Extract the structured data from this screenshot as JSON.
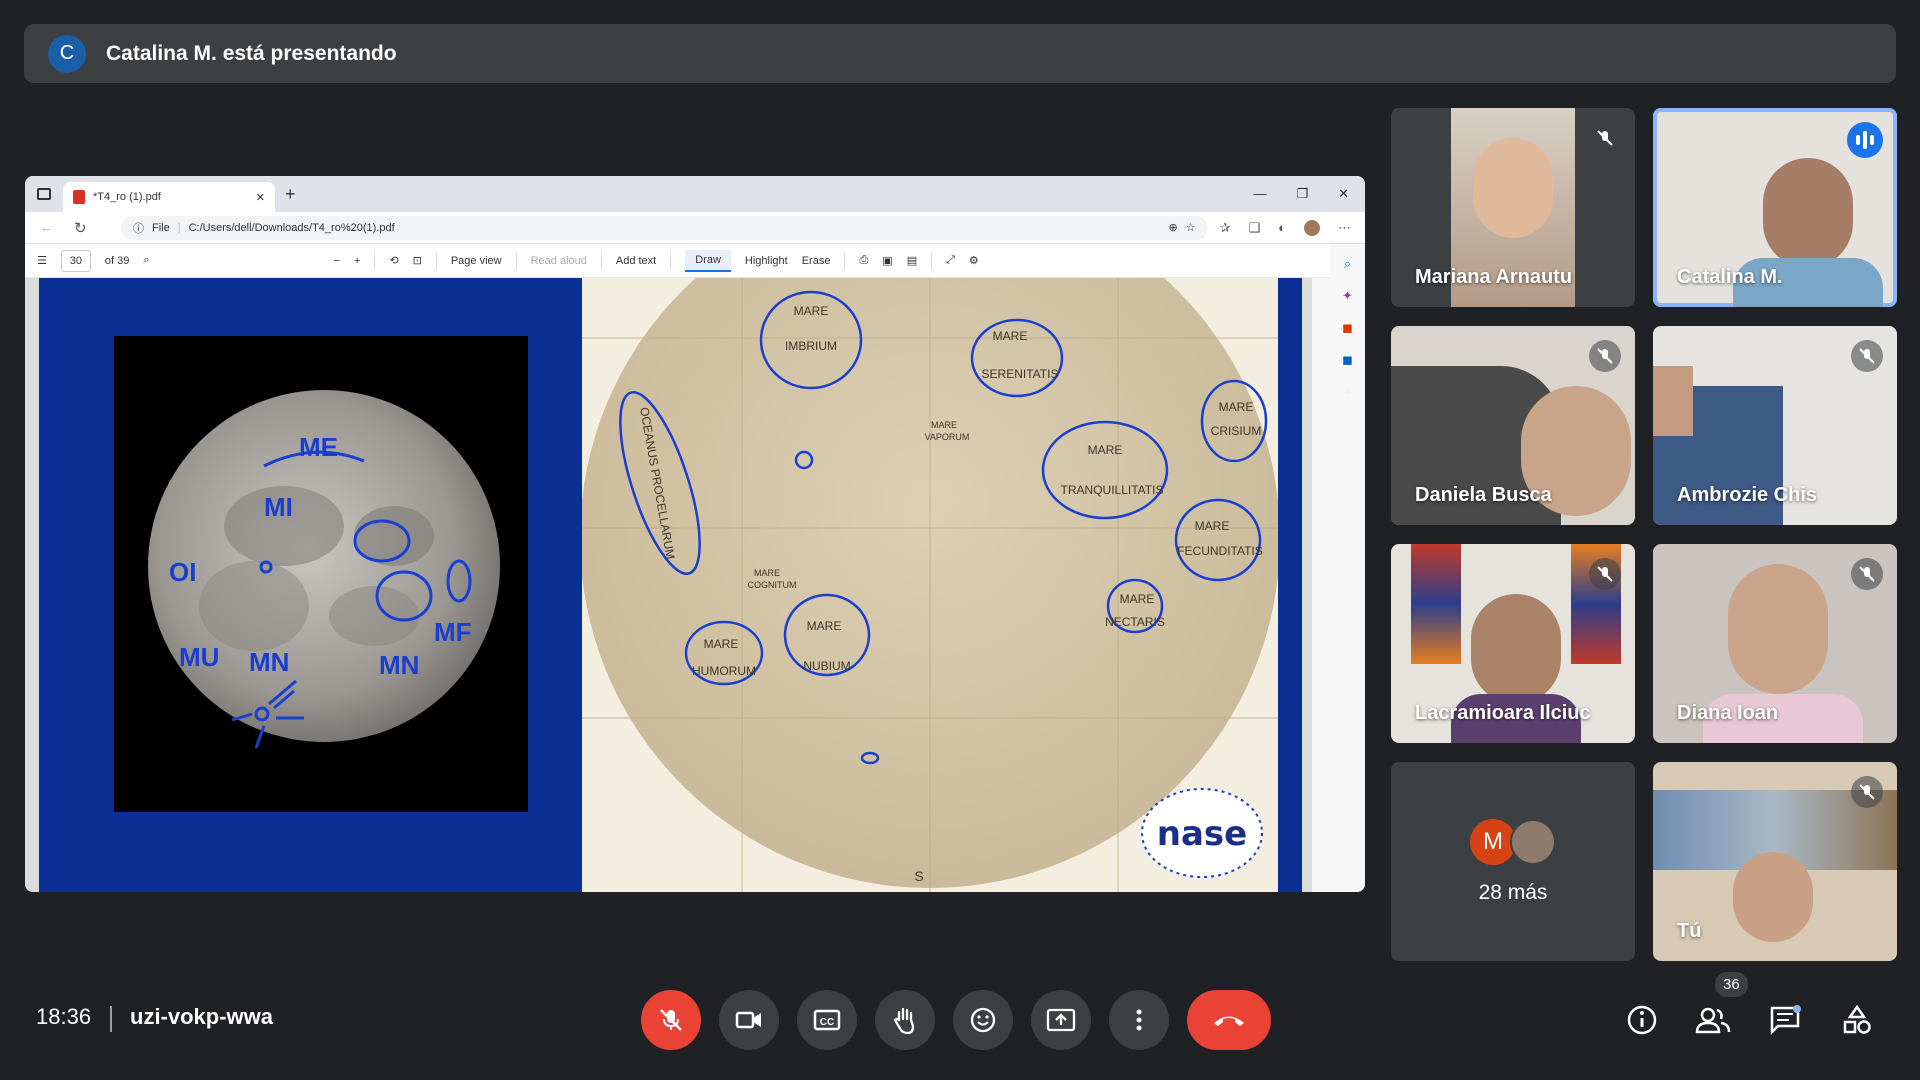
{
  "banner": {
    "avatar_letter": "C",
    "text": "Catalina M. está presentando"
  },
  "browser": {
    "tab_title": "*T4_ro (1).pdf",
    "url_prefix": "File",
    "url": "C:/Users/dell/Downloads/T4_ro%20(1).pdf",
    "page_current": "30",
    "page_total": "of 39",
    "tools": {
      "page_view": "Page view",
      "read_aloud": "Read aloud",
      "add_text": "Add text",
      "draw": "Draw",
      "highlight": "Highlight",
      "erase": "Erase"
    }
  },
  "slide": {
    "moon_annotations": [
      "ME",
      "MI",
      "OI",
      "MU",
      "MN",
      "MN",
      "MF"
    ],
    "map_labels": {
      "imbrium": [
        "MARE",
        "IMBRIUM"
      ],
      "serenitatis": [
        "MARE",
        "SERENITATIS"
      ],
      "crisium": [
        "MARE",
        "CRISIUM"
      ],
      "oceanus": "OCEANUS PROCELLARUM",
      "tranquillitatis": [
        "MARE",
        "TRANQUILLITATIS"
      ],
      "fecunditatis": [
        "MARE",
        "FECUNDITATIS"
      ],
      "nectaris": [
        "MARE",
        "NECTARIS"
      ],
      "humorum": [
        "MARE",
        "HUMORUM"
      ],
      "nubium": [
        "MARE",
        "NUBIUM"
      ],
      "cognitum": [
        "MARE",
        "COGNITUM"
      ],
      "vaporum": [
        "MARE",
        "VAPORUM"
      ],
      "south": "S",
      "logo": "nase"
    }
  },
  "participants": [
    {
      "name": "Mariana Arnautu",
      "muted": true
    },
    {
      "name": "Catalina M.",
      "muted": false,
      "speaking": true
    },
    {
      "name": "Daniela Busca",
      "muted": true
    },
    {
      "name": "Ambrozie Chis",
      "muted": true
    },
    {
      "name": "Lacramioara Ilciuc",
      "muted": true
    },
    {
      "name": "Diana Ioan",
      "muted": true
    },
    {
      "name": "Tú",
      "muted": true
    }
  ],
  "more_tile": {
    "avatar_letter": "M",
    "count_text": "28 más"
  },
  "bottom": {
    "time": "18:36",
    "meeting_code": "uzi-vokp-wwa",
    "people_count": "36"
  },
  "colors": {
    "bg": "#202124",
    "tile": "#3c4043",
    "red": "#ea4335",
    "accent": "#8ab4f8",
    "ink": "#1a3fd0"
  }
}
